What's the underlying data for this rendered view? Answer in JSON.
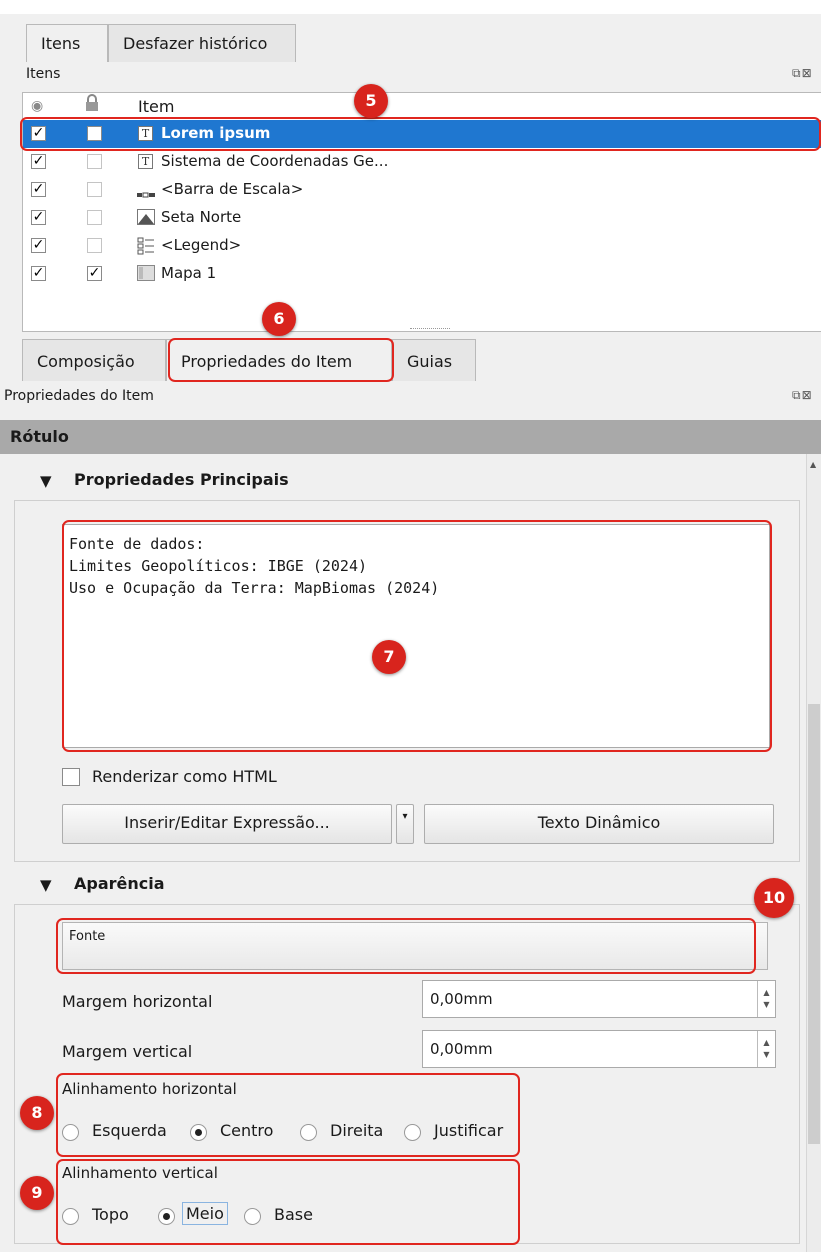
{
  "top_tabs": [
    "Itens",
    "Desfazer histórico"
  ],
  "items_panel": {
    "title": "Itens",
    "dock_buttons": "⧉⊠",
    "column_item": "Item",
    "rows": [
      {
        "visible": "✓",
        "locked": "",
        "icon": "text-icon",
        "label": "Lorem ipsum"
      },
      {
        "visible": "✓",
        "locked": "",
        "icon": "text-icon",
        "label": "Sistema de Coordenadas Ge..."
      },
      {
        "visible": "✓",
        "locked": "",
        "icon": "scalebar-icon",
        "label": "<Barra de Escala>"
      },
      {
        "visible": "✓",
        "locked": "",
        "icon": "north-arrow-icon",
        "label": "Seta Norte"
      },
      {
        "visible": "✓",
        "locked": "",
        "icon": "legend-icon",
        "label": "<Legend>"
      },
      {
        "visible": "✓",
        "locked": "✓",
        "icon": "map-icon",
        "label": "Mapa 1"
      }
    ]
  },
  "mid_tabs": [
    "Composição",
    "Propriedades do Item",
    "Guias"
  ],
  "props_panel": {
    "title": "Propriedades do Item",
    "dock_buttons": "⧉⊠"
  },
  "section_title": "Rótulo",
  "main_props": {
    "title": "Propriedades Principais",
    "text_lines": [
      "Fonte de dados:",
      "Limites Geopolíticos: IBGE (2024)",
      "Uso e Ocupação da Terra: MapBiomas (2024)"
    ],
    "render_html": "Renderizar como HTML",
    "insert_expression": "Inserir/Editar Expressão...",
    "dynamic_text": "Texto Dinâmico"
  },
  "appearance": {
    "title": "Aparência",
    "font_label": "Fonte",
    "h_margin_label": "Margem horizontal",
    "h_margin_value": "0,00mm",
    "v_margin_label": "Margem vertical",
    "v_margin_value": "0,00mm",
    "h_align_label": "Alinhamento horizontal",
    "h_align_options": [
      "Esquerda",
      "Centro",
      "Direita",
      "Justificar"
    ],
    "h_align_selected": "Centro",
    "v_align_label": "Alinhamento vertical",
    "v_align_options": [
      "Topo",
      "Meio",
      "Base"
    ],
    "v_align_selected": "Meio"
  },
  "badges": [
    "5",
    "6",
    "7",
    "8",
    "9",
    "10"
  ],
  "colors": {
    "selection": "#1f77d0",
    "annotation_red": "#e0261f",
    "section_bar": "#a9a9a9"
  }
}
